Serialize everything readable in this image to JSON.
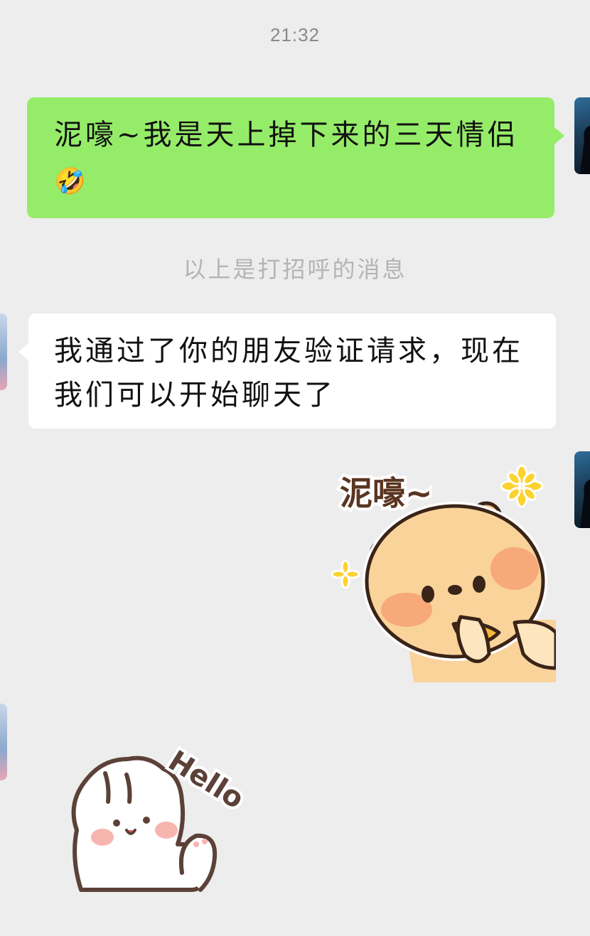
{
  "status": {
    "time": "21:32"
  },
  "messages": [
    {
      "sender": "me",
      "text": "泥嚎~我是天上掉下来的三天情侣",
      "emoji": "🤣"
    },
    {
      "sender": "system",
      "text": "以上是打招呼的消息"
    },
    {
      "sender": "them",
      "text": "我通过了你的朋友验证请求，现在我们可以开始聊天了"
    },
    {
      "sender": "me",
      "sticker": "bear-greeting-sticker",
      "caption": "泥嚎~"
    },
    {
      "sender": "them",
      "sticker": "bunny-hello-sticker",
      "caption": "Hello"
    }
  ],
  "colors": {
    "background": "#ededed",
    "my_bubble": "#95ec69",
    "their_bubble": "#ffffff",
    "timestamp_text": "#8a8a8a",
    "system_text": "#b4b4b4"
  }
}
